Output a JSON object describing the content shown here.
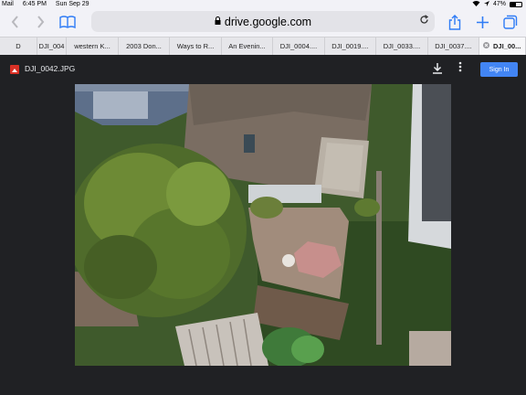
{
  "status_bar": {
    "app_back": "Mail",
    "time": "6:45 PM",
    "date": "Sun Sep 29",
    "battery": "47%",
    "battery_level": 0.47
  },
  "toolbar": {
    "url": "drive.google.com"
  },
  "tabs": [
    {
      "label": "D"
    },
    {
      "label": "DJI_004"
    },
    {
      "label": "western K..."
    },
    {
      "label": "2003 Don..."
    },
    {
      "label": "Ways to R..."
    },
    {
      "label": "An Evenin..."
    },
    {
      "label": "DJI_0004...."
    },
    {
      "label": "DJI_0019...."
    },
    {
      "label": "DJI_0033...."
    },
    {
      "label": "DJI_0037...."
    },
    {
      "label": "DJI_00...",
      "active": true
    }
  ],
  "viewer": {
    "file_name": "DJI_0042.JPG",
    "sign_in_label": "Sign In"
  },
  "icons": {
    "back": "chevron-left-icon",
    "forward": "chevron-right-icon",
    "bookmarks": "book-icon",
    "lock": "lock-icon",
    "reload": "reload-icon",
    "share": "share-icon",
    "new_tab": "plus-icon",
    "tabs_overview": "tabs-icon",
    "file_type": "image-file-icon",
    "download": "download-icon",
    "more": "more-vertical-icon",
    "close_tab": "close-icon"
  },
  "colors": {
    "accent": "#2f7cf6",
    "signin": "#4285f4",
    "viewer_bg": "#202124"
  }
}
